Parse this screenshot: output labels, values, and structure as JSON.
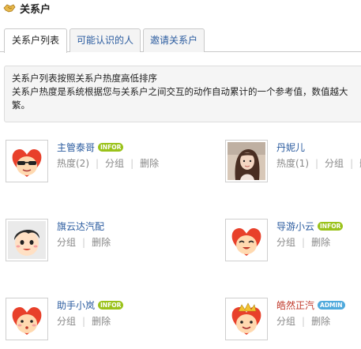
{
  "header": {
    "title": "关系户"
  },
  "tabs": [
    {
      "label": "关系户列表",
      "active": true
    },
    {
      "label": "可能认识的人",
      "active": false
    },
    {
      "label": "邀请关系户",
      "active": false
    }
  ],
  "notice": {
    "line1": "关系户列表按照关系户热度高低排序",
    "line2": "关系户热度是系统根据您与关系户之间交互的动作自动累计的一个参考值，数值越大",
    "line3": "繁。"
  },
  "contacts": [
    {
      "name": "主管泰哥",
      "badge": "INFOR",
      "badge_color": "#9ac21a",
      "heat": "热度(2)",
      "group": "分组",
      "delete": "删除",
      "avatar": "heart-sunglasses-icon"
    },
    {
      "name": "丹妮儿",
      "badge": "",
      "badge_color": "",
      "heat": "热度(1)",
      "group": "分组",
      "delete": "删除",
      "avatar": "photo-avatar"
    },
    {
      "name": "旗云达汽配",
      "badge": "",
      "badge_color": "",
      "heat": "",
      "group": "分组",
      "delete": "删除",
      "avatar": "cartoon-boy-icon"
    },
    {
      "name": "导游小云",
      "badge": "INFOR",
      "badge_color": "#9ac21a",
      "heat": "",
      "group": "分组",
      "delete": "删除",
      "avatar": "heart-smile-icon"
    },
    {
      "name": "助手小岚",
      "badge": "INFOR",
      "badge_color": "#9ac21a",
      "heat": "",
      "group": "分组",
      "delete": "删除",
      "avatar": "heart-blush-icon"
    },
    {
      "name": "皓然正汽",
      "badge": "ADMIN",
      "badge_color": "#4fa9dc",
      "heat": "",
      "group": "分组",
      "delete": "删除",
      "avatar": "heart-king-icon"
    }
  ]
}
